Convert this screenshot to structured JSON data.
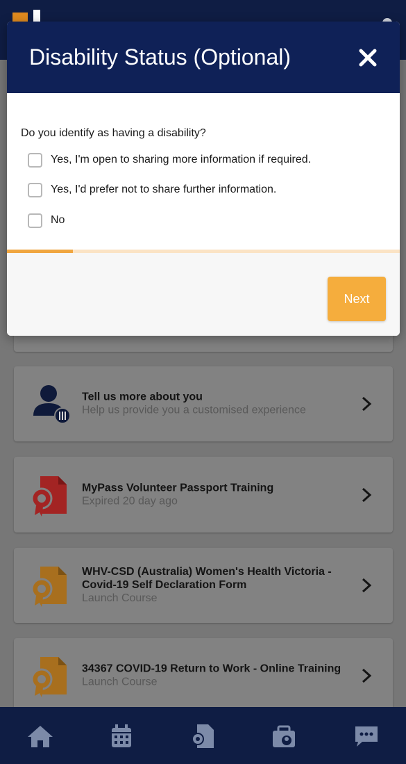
{
  "modal": {
    "title": "Disability Status (Optional)",
    "question": "Do you identify as having a disability?",
    "options": [
      {
        "label": "Yes, I'm open to sharing more information if required.",
        "checked": false
      },
      {
        "label": "Yes, I'd prefer not to share further information.",
        "checked": false
      },
      {
        "label": "No",
        "checked": false
      }
    ],
    "progress_fraction": 0.167,
    "next_label": "Next",
    "close_icon": "close-icon"
  },
  "cards": [
    {
      "title": "Tell us more about you",
      "subtitle": "Help us provide you a customised experience",
      "icon": "user-settings-icon"
    },
    {
      "title": "MyPass Volunteer Passport Training",
      "subtitle": "Expired 20 day ago",
      "icon": "certificate-icon"
    },
    {
      "title": "WHV-CSD (Australia) Women's Health Victoria - Covid-19 Self Declaration Form",
      "subtitle": "Launch Course",
      "icon": "certificate-icon"
    },
    {
      "title": "34367 COVID-19 Return to Work - Online Training",
      "subtitle": "Launch Course",
      "icon": "certificate-icon"
    }
  ],
  "bottom_nav": [
    {
      "icon": "home-icon"
    },
    {
      "icon": "calendar-icon"
    },
    {
      "icon": "courses-icon"
    },
    {
      "icon": "passport-icon"
    },
    {
      "icon": "chat-icon"
    }
  ],
  "colors": {
    "header_navy": "#0f2157",
    "accent_orange": "#f5ad3d",
    "expired_red": "#a32423",
    "course_orange": "#a86f1e"
  }
}
